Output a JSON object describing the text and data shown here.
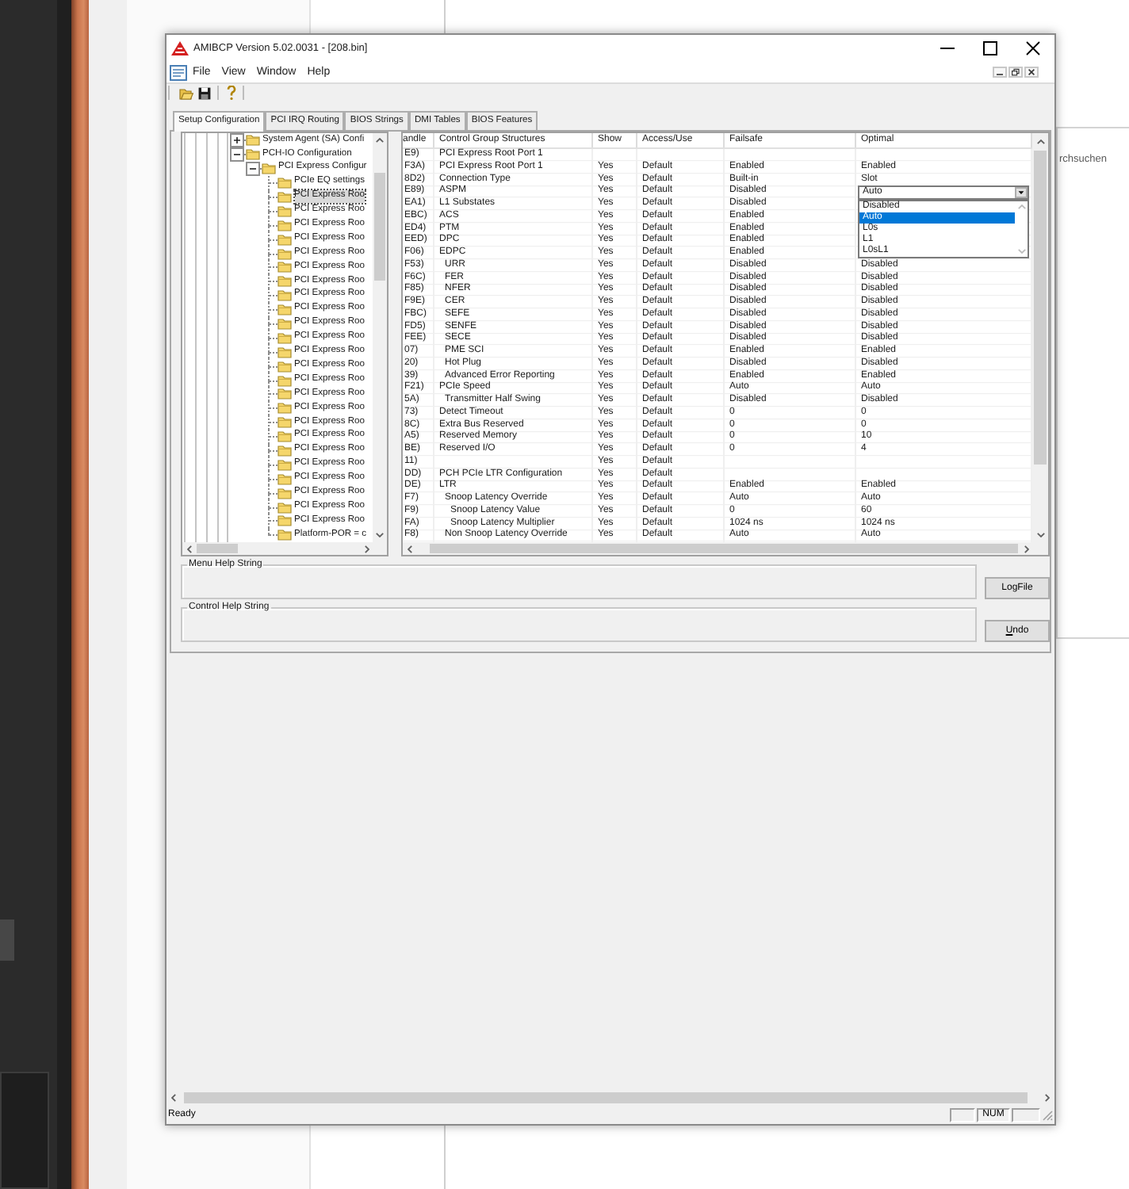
{
  "background": {
    "side_window_label": "rchsuchen"
  },
  "window": {
    "title": "AMIBCP Version 5.02.0031 - [208.bin]"
  },
  "menu": [
    "File",
    "View",
    "Window",
    "Help"
  ],
  "tabs": [
    {
      "label": "Setup Configuration",
      "selected": true
    },
    {
      "label": "PCI IRQ Routing",
      "selected": false
    },
    {
      "label": "BIOS Strings",
      "selected": false
    },
    {
      "label": "DMI Tables",
      "selected": false
    },
    {
      "label": "BIOS Features",
      "selected": false
    }
  ],
  "tree": {
    "items": [
      {
        "label": "System Agent (SA) Confi",
        "expanded": false,
        "selected": false
      },
      {
        "label": "PCH-IO Configuration",
        "expanded": true,
        "selected": false,
        "children": [
          {
            "label": "PCI Express Configur",
            "expanded": true,
            "selected": false,
            "children": [
              {
                "label": "PCIe EQ settings",
                "selected": false
              },
              {
                "label": "PCI Express Roo",
                "selected": true
              },
              {
                "label": "PCI Express Roo",
                "selected": false
              },
              {
                "label": "PCI Express Roo",
                "selected": false
              },
              {
                "label": "PCI Express Roo",
                "selected": false
              },
              {
                "label": "PCI Express Roo",
                "selected": false
              },
              {
                "label": "PCI Express Roo",
                "selected": false
              },
              {
                "label": "PCI Express Roo",
                "selected": false
              },
              {
                "label": "PCI Express Roo",
                "selected": false
              },
              {
                "label": "PCI Express Roo",
                "selected": false
              },
              {
                "label": "PCI Express Roo",
                "selected": false
              },
              {
                "label": "PCI Express Roo",
                "selected": false
              },
              {
                "label": "PCI Express Roo",
                "selected": false
              },
              {
                "label": "PCI Express Roo",
                "selected": false
              },
              {
                "label": "PCI Express Roo",
                "selected": false
              },
              {
                "label": "PCI Express Roo",
                "selected": false
              },
              {
                "label": "PCI Express Roo",
                "selected": false
              },
              {
                "label": "PCI Express Roo",
                "selected": false
              },
              {
                "label": "PCI Express Roo",
                "selected": false
              },
              {
                "label": "PCI Express Roo",
                "selected": false
              },
              {
                "label": "PCI Express Roo",
                "selected": false
              },
              {
                "label": "PCI Express Roo",
                "selected": false
              },
              {
                "label": "PCI Express Roo",
                "selected": false
              },
              {
                "label": "PCI Express Roo",
                "selected": false
              },
              {
                "label": "PCI Express Roo",
                "selected": false
              },
              {
                "label": "Platform-POR = c",
                "selected": false
              }
            ]
          }
        ]
      }
    ]
  },
  "table": {
    "columns": [
      "andle",
      "Control Group Structures",
      "Show",
      "Access/Use",
      "Failsafe",
      "Optimal"
    ],
    "rows": [
      {
        "handle": "E9)",
        "name": "PCI Express Root Port 1"
      },
      {
        "handle": "F3A)",
        "name": "PCI Express Root Port 1",
        "show": "Yes",
        "access": "Default",
        "failsafe": "Enabled",
        "optimal": "Enabled"
      },
      {
        "handle": "8D2)",
        "name": "Connection Type",
        "show": "Yes",
        "access": "Default",
        "failsafe": "Built-in",
        "optimal": "Slot"
      },
      {
        "handle": "E89)",
        "name": "ASPM",
        "show": "Yes",
        "access": "Default",
        "failsafe": "Disabled",
        "optimal_dropdown": {
          "value": "Auto",
          "open": true,
          "options": [
            {
              "label": "Disabled",
              "selected": false
            },
            {
              "label": "Auto",
              "selected": true
            },
            {
              "label": "L0s",
              "selected": false
            },
            {
              "label": "L1",
              "selected": false
            },
            {
              "label": "L0sL1",
              "selected": false
            }
          ]
        }
      },
      {
        "handle": "EA1)",
        "name": "L1 Substates",
        "show": "Yes",
        "access": "Default",
        "failsafe": "Disabled"
      },
      {
        "handle": "EBC)",
        "name": "ACS",
        "show": "Yes",
        "access": "Default",
        "failsafe": "Enabled"
      },
      {
        "handle": "ED4)",
        "name": "PTM",
        "show": "Yes",
        "access": "Default",
        "failsafe": "Enabled"
      },
      {
        "handle": "EED)",
        "name": "DPC",
        "show": "Yes",
        "access": "Default",
        "failsafe": "Enabled"
      },
      {
        "handle": "F06)",
        "name": "EDPC",
        "show": "Yes",
        "access": "Default",
        "failsafe": "Enabled",
        "children": [
          {
            "handle": "F53)",
            "name": "URR",
            "show": "Yes",
            "access": "Default",
            "failsafe": "Disabled",
            "optimal": "Disabled"
          },
          {
            "handle": "F6C)",
            "name": "FER",
            "show": "Yes",
            "access": "Default",
            "failsafe": "Disabled",
            "optimal": "Disabled"
          },
          {
            "handle": "F85)",
            "name": "NFER",
            "show": "Yes",
            "access": "Default",
            "failsafe": "Disabled",
            "optimal": "Disabled"
          },
          {
            "handle": "F9E)",
            "name": "CER",
            "show": "Yes",
            "access": "Default",
            "failsafe": "Disabled",
            "optimal": "Disabled"
          },
          {
            "handle": "FBC)",
            "name": "SEFE",
            "show": "Yes",
            "access": "Default",
            "failsafe": "Disabled",
            "optimal": "Disabled"
          },
          {
            "handle": "FD5)",
            "name": "SENFE",
            "show": "Yes",
            "access": "Default",
            "failsafe": "Disabled",
            "optimal": "Disabled"
          },
          {
            "handle": "FEE)",
            "name": "SECE",
            "show": "Yes",
            "access": "Default",
            "failsafe": "Disabled",
            "optimal": "Disabled"
          },
          {
            "handle": "07)",
            "name": "PME SCI",
            "show": "Yes",
            "access": "Default",
            "failsafe": "Enabled",
            "optimal": "Enabled"
          },
          {
            "handle": "20)",
            "name": "Hot Plug",
            "show": "Yes",
            "access": "Default",
            "failsafe": "Disabled",
            "optimal": "Disabled"
          },
          {
            "handle": "39)",
            "name": "Advanced Error Reporting",
            "show": "Yes",
            "access": "Default",
            "failsafe": "Enabled",
            "optimal": "Enabled"
          }
        ]
      },
      {
        "handle": "F21)",
        "name": "PCIe Speed",
        "show": "Yes",
        "access": "Default",
        "failsafe": "Auto",
        "optimal": "Auto",
        "children": [
          {
            "handle": "5A)",
            "name": "Transmitter Half Swing",
            "show": "Yes",
            "access": "Default",
            "failsafe": "Disabled",
            "optimal": "Disabled"
          }
        ]
      },
      {
        "handle": "73)",
        "name": "Detect Timeout",
        "show": "Yes",
        "access": "Default",
        "failsafe": "0",
        "optimal": "0"
      },
      {
        "handle": "8C)",
        "name": "Extra Bus Reserved",
        "show": "Yes",
        "access": "Default",
        "failsafe": "0",
        "optimal": "0"
      },
      {
        "handle": "A5)",
        "name": "Reserved Memory",
        "show": "Yes",
        "access": "Default",
        "failsafe": "0",
        "optimal": "10"
      },
      {
        "handle": "BE)",
        "name": "Reserved I/O",
        "show": "Yes",
        "access": "Default",
        "failsafe": "0",
        "optimal": "4"
      },
      {
        "handle": "11)",
        "show": "Yes",
        "access": "Default"
      },
      {
        "handle": "DD)",
        "name": "PCH PCIe LTR Configuration",
        "show": "Yes",
        "access": "Default"
      },
      {
        "handle": "DE)",
        "name": "LTR",
        "show": "Yes",
        "access": "Default",
        "failsafe": "Enabled",
        "optimal": "Enabled",
        "children": [
          {
            "handle": "F7)",
            "name": "Snoop Latency Override",
            "show": "Yes",
            "access": "Default",
            "failsafe": "Auto",
            "optimal": "Auto",
            "children": [
              {
                "handle": "F9)",
                "name": "Snoop Latency Value",
                "show": "Yes",
                "access": "Default",
                "failsafe": "0",
                "optimal": "60"
              },
              {
                "handle": "FA)",
                "name": "Snoop Latency Multiplier",
                "show": "Yes",
                "access": "Default",
                "failsafe": "1024 ns",
                "optimal": "1024 ns"
              }
            ]
          },
          {
            "handle": "F8)",
            "name": "Non Snoop Latency Override",
            "show": "Yes",
            "access": "Default",
            "failsafe": "Auto",
            "optimal": "Auto"
          }
        ]
      }
    ]
  },
  "help_rows": [
    {
      "label": "Menu Help String",
      "button": "LogFile"
    },
    {
      "label": "Control Help String",
      "button": "Undo",
      "mnemonic": true
    }
  ],
  "status_bar": {
    "text": "Ready",
    "indicator": "NUM"
  }
}
